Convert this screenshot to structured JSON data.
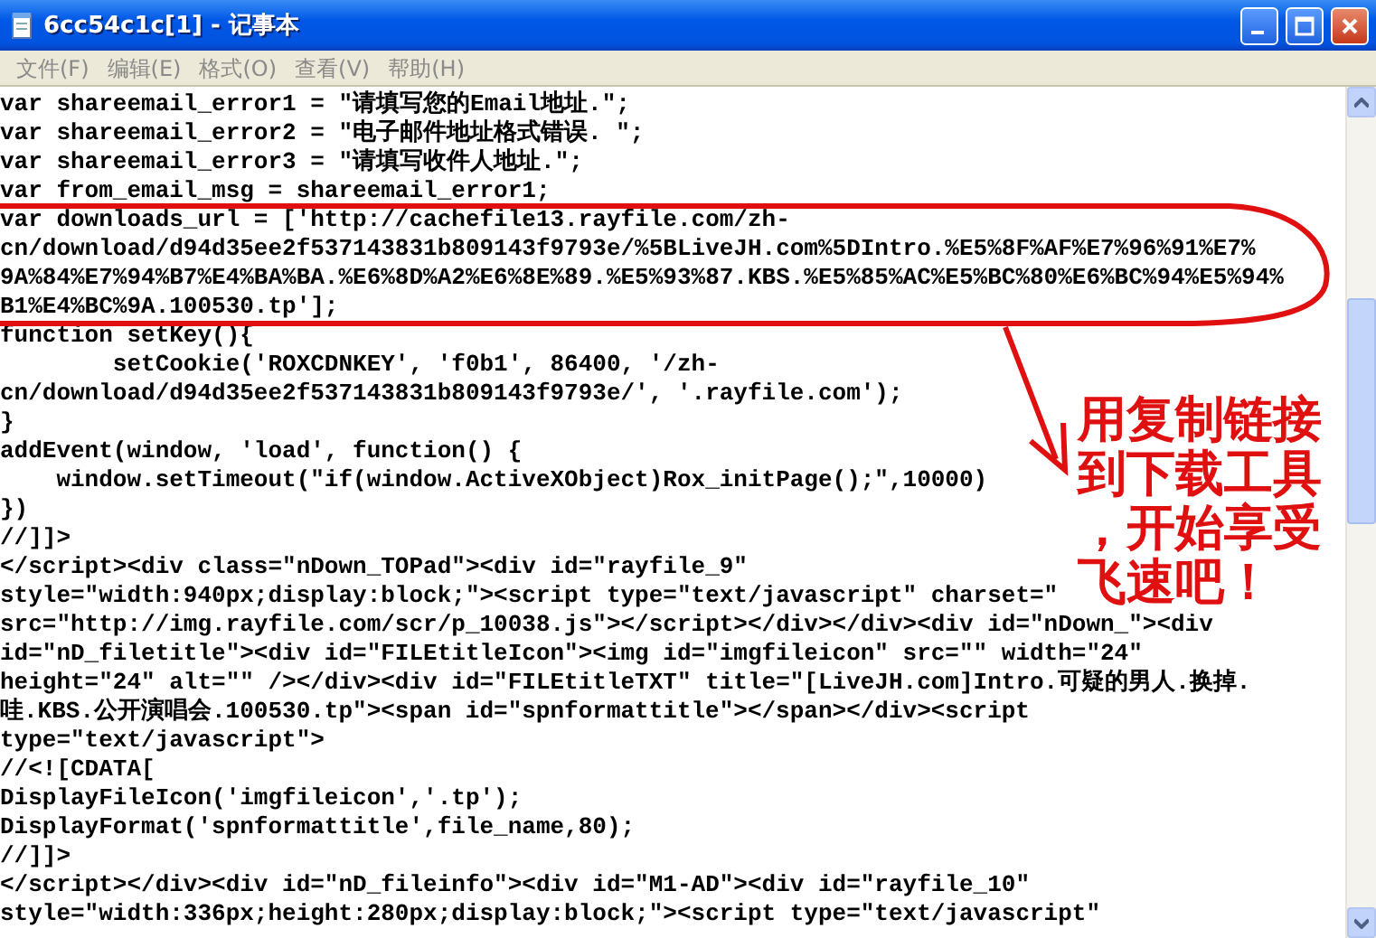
{
  "window": {
    "title": "6cc54c1c[1] - 记事本"
  },
  "menu": [
    {
      "label": "文件(F)"
    },
    {
      "label": "编辑(E)"
    },
    {
      "label": "格式(O)"
    },
    {
      "label": "查看(V)"
    },
    {
      "label": "帮助(H)"
    }
  ],
  "lines": [
    "var shareemail_error1 = \"请填写您的Email地址.\";",
    "var shareemail_error2 = \"电子邮件地址格式错误. \";",
    "var shareemail_error3 = \"请填写收件人地址.\";",
    "var from_email_msg = shareemail_error1;",
    "var downloads_url = ['http://cachefile13.rayfile.com/zh-",
    "cn/download/d94d35ee2f537143831b809143f9793e/%5BLiveJH.com%5DIntro.%E5%8F%AF%E7%96%91%E7%",
    "9A%84%E7%94%B7%E4%BA%BA.%E6%8D%A2%E6%8E%89.%E5%93%87.KBS.%E5%85%AC%E5%BC%80%E6%BC%94%E5%94%",
    "B1%E4%BC%9A.100530.tp'];",
    "function setKey(){",
    "        setCookie('ROXCDNKEY', 'f0b1', 86400, '/zh-",
    "cn/download/d94d35ee2f537143831b809143f9793e/', '.rayfile.com');",
    "}",
    "addEvent(window, 'load', function() {",
    "    window.setTimeout(\"if(window.ActiveXObject)Rox_initPage();\",10000)",
    "})",
    "//]]>",
    "</script><div class=\"nDown_TOPad\"><div id=\"rayfile_9\"",
    "style=\"width:940px;display:block;\"><script type=\"text/javascript\" charset=\"",
    "src=\"http://img.rayfile.com/scr/p_10038.js\"></script></div></div><div id=\"nDown_\"><div",
    "id=\"nD_filetitle\"><div id=\"FILEtitleIcon\"><img id=\"imgfileicon\" src=\"\" width=\"24\"",
    "height=\"24\" alt=\"\" /></div><div id=\"FILEtitleTXT\" title=\"[LiveJH.com]Intro.可疑的男人.换掉.",
    "哇.KBS.公开演唱会.100530.tp\"><span id=\"spnformattitle\"></span></div><script",
    "type=\"text/javascript\">",
    "//<![CDATA[",
    "DisplayFileIcon('imgfileicon','.tp');",
    "DisplayFormat('spnformattitle',file_name,80);",
    "//]]>",
    "</script></div><div id=\"nD_fileinfo\"><div id=\"M1-AD\"><div id=\"rayfile_10\"",
    "style=\"width:336px;height:280px;display:block;\"><script type=\"text/javascript\""
  ],
  "annotation": {
    "lines": [
      "用复制链接",
      "到下载工具",
      "，开始享受",
      "飞速吧！"
    ]
  }
}
